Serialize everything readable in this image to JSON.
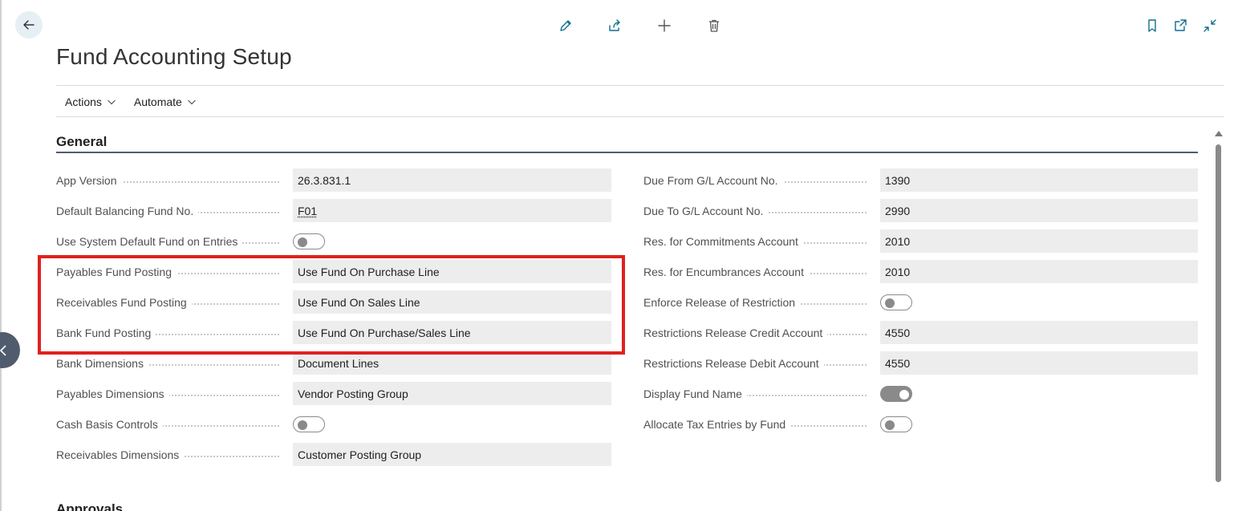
{
  "page": {
    "title": "Fund Accounting Setup"
  },
  "toolbar": {
    "icons": [
      "back-arrow-icon",
      "edit-pencil-icon",
      "share-icon",
      "new-plus-icon",
      "delete-trash-icon",
      "bookmark-icon",
      "open-new-window-icon",
      "collapse-icon"
    ]
  },
  "menu": {
    "actions_label": "Actions",
    "automate_label": "Automate"
  },
  "general": {
    "title": "General",
    "left": {
      "app_version_label": "App Version",
      "app_version_value": "26.3.831.1",
      "default_balancing_fund_label": "Default Balancing Fund No.",
      "default_balancing_fund_value": "F01",
      "use_system_default_fund_label": "Use System Default Fund on Entries",
      "use_system_default_fund_value": false,
      "payables_fund_posting_label": "Payables Fund Posting",
      "payables_fund_posting_value": "Use Fund On Purchase Line",
      "receivables_fund_posting_label": "Receivables Fund Posting",
      "receivables_fund_posting_value": "Use Fund On Sales Line",
      "bank_fund_posting_label": "Bank Fund Posting",
      "bank_fund_posting_value": "Use Fund On Purchase/Sales Line",
      "bank_dimensions_label": "Bank Dimensions",
      "bank_dimensions_value": "Document Lines",
      "payables_dimensions_label": "Payables Dimensions",
      "payables_dimensions_value": "Vendor Posting Group",
      "cash_basis_controls_label": "Cash Basis Controls",
      "cash_basis_controls_value": false,
      "receivables_dimensions_label": "Receivables Dimensions",
      "receivables_dimensions_value": "Customer Posting Group"
    },
    "right": {
      "due_from_gl_label": "Due From G/L Account No.",
      "due_from_gl_value": "1390",
      "due_to_gl_label": "Due To G/L Account No.",
      "due_to_gl_value": "2990",
      "res_commitments_label": "Res. for Commitments Account",
      "res_commitments_value": "2010",
      "res_encumbrances_label": "Res. for Encumbrances Account",
      "res_encumbrances_value": "2010",
      "enforce_release_label": "Enforce Release of Restriction",
      "enforce_release_value": false,
      "release_credit_label": "Restrictions Release Credit Account",
      "release_credit_value": "4550",
      "release_debit_label": "Restrictions Release Debit Account",
      "release_debit_value": "4550",
      "display_fund_name_label": "Display Fund Name",
      "display_fund_name_value": true,
      "allocate_tax_label": "Allocate Tax Entries by Fund",
      "allocate_tax_value": false
    }
  },
  "next_section": {
    "title": "Approvals"
  },
  "colors": {
    "accent": "#0f6e8c",
    "highlight": "#e02020",
    "section_rule": "#505c6d",
    "field_bg": "#ededed"
  }
}
